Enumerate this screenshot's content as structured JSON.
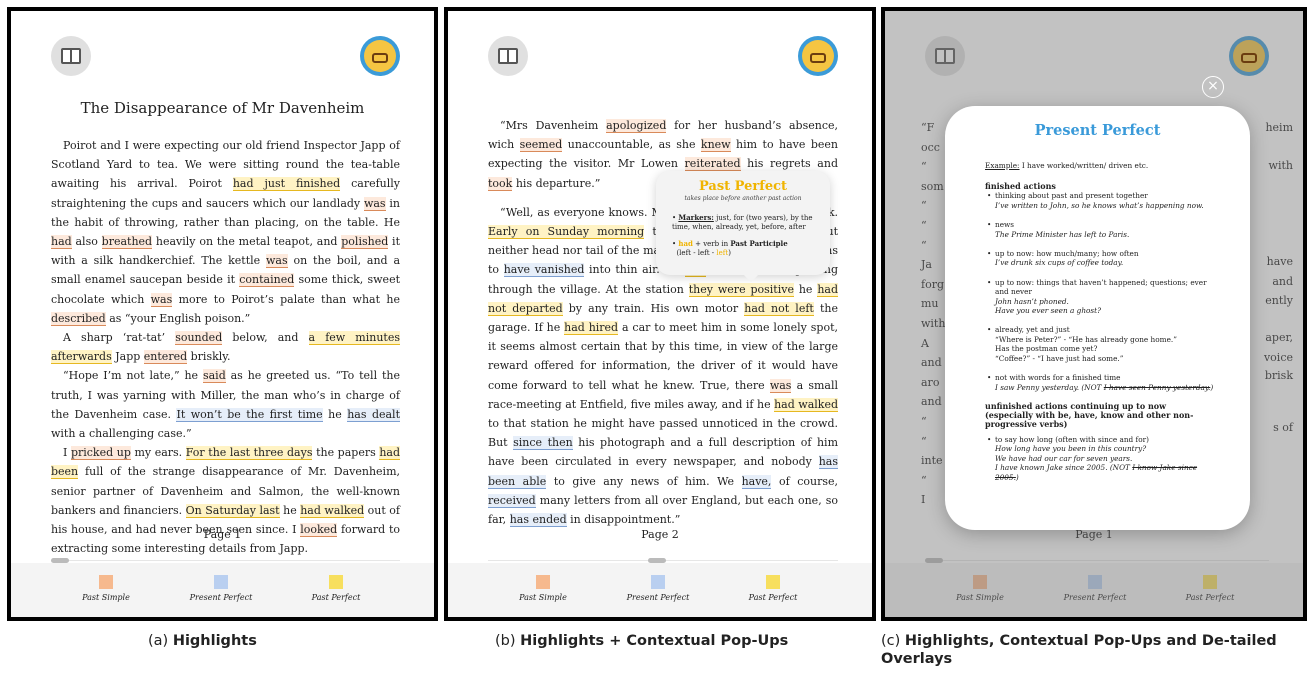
{
  "panels": {
    "p1": {
      "title": "The Disappearance of Mr Davenheim",
      "page": "Page 1",
      "paragraphs": [
        [
          [
            "Poirot and I were expecting our old friend Inspector Japp of Scotland Yard to tea. We were sitting round the tea-table awaiting his arrival. Poirot ",
            ""
          ],
          [
            "had just finished",
            "y"
          ],
          [
            " carefully straightening the cups and saucers which our landlady ",
            ""
          ],
          [
            "was",
            "o"
          ],
          [
            " in the habit of throwing, rather than placing, on the table. He ",
            ""
          ],
          [
            "had",
            "o"
          ],
          [
            " also ",
            ""
          ],
          [
            "breathed",
            "o"
          ],
          [
            " heavily on the metal teapot, and ",
            ""
          ],
          [
            "polished",
            "o"
          ],
          [
            " it with a silk handkerchief. The kettle ",
            ""
          ],
          [
            "was",
            "o"
          ],
          [
            " on the boil, and a small enamel saucepan beside it ",
            ""
          ],
          [
            "contained",
            "o"
          ],
          [
            " some thick, sweet chocolate which ",
            ""
          ],
          [
            "was",
            "o"
          ],
          [
            " more to Poirot’s palate than what he ",
            ""
          ],
          [
            "described",
            "o"
          ],
          [
            " as “your English poison.”",
            ""
          ]
        ],
        [
          [
            "A sharp ‘rat-tat’ ",
            ""
          ],
          [
            "sounded",
            "o"
          ],
          [
            " below, and ",
            ""
          ],
          [
            "a few minutes afterwards",
            "y"
          ],
          [
            " Japp ",
            ""
          ],
          [
            "entered",
            "o"
          ],
          [
            " briskly.",
            ""
          ]
        ],
        [
          [
            "“Hope I’m not late,” he ",
            ""
          ],
          [
            "said",
            "o"
          ],
          [
            " as he greeted us. “To tell the truth, I was yarning with Miller, the man who’s in charge of the Davenheim case. ",
            ""
          ],
          [
            "It won’t be the first time",
            "b"
          ],
          [
            " he ",
            ""
          ],
          [
            "has dealt",
            "b"
          ],
          [
            " with a challenging case.”",
            ""
          ]
        ],
        [
          [
            "I ",
            ""
          ],
          [
            "pricked up",
            "o"
          ],
          [
            " my ears. ",
            ""
          ],
          [
            "For the last three days",
            "y"
          ],
          [
            " the papers ",
            ""
          ],
          [
            "had been",
            "y"
          ],
          [
            " full of the strange disappearance of Mr. Davenheim, senior partner of Davenheim and Salmon, the well-known bankers and financiers. ",
            ""
          ],
          [
            "On Saturday last",
            "y"
          ],
          [
            " he ",
            ""
          ],
          [
            "had walked",
            "y"
          ],
          [
            " out of his house, and had never been seen since. I ",
            ""
          ],
          [
            "looked",
            "o"
          ],
          [
            " forward to extracting some interesting details from Japp.",
            ""
          ]
        ]
      ]
    },
    "p2": {
      "page": "Page 2",
      "paragraphs": [
        [
          [
            "“Mrs Davenheim ",
            ""
          ],
          [
            "apologized",
            "o"
          ],
          [
            " for her husband’s absence, wich ",
            ""
          ],
          [
            "seemed",
            "o"
          ],
          [
            " unaccountable, as she ",
            ""
          ],
          [
            "knew",
            "o"
          ],
          [
            " him to have been expecting the visitor. Mr Lowen ",
            ""
          ],
          [
            "reiterated",
            "o"
          ],
          [
            " his regrets and ",
            ""
          ],
          [
            "took",
            "o"
          ],
          [
            " his departure.”",
            ""
          ]
        ],
        [
          [
            "“Well, as everyone knows. Mr Davenheim never came back. ",
            ""
          ],
          [
            "Early on Sunday morning",
            "y"
          ],
          [
            " the police were called in, but neither head nor tail of the matter could they make. He seems to ",
            ""
          ],
          [
            "have vanished",
            "b"
          ],
          [
            " into thin air. He ",
            ""
          ],
          [
            "had",
            "y"
          ],
          [
            " not been seen passing through the village. At the station ",
            ""
          ],
          [
            "they were positive",
            "y"
          ],
          [
            " he ",
            ""
          ],
          [
            "had not departed",
            "y"
          ],
          [
            " by any train. His own motor ",
            ""
          ],
          [
            "had not left",
            "y"
          ],
          [
            " the garage. If he ",
            ""
          ],
          [
            "had hired",
            "y"
          ],
          [
            " a car to meet him in some lonely spot, it seems almost certain that by this time, in view of the large reward offered for information, the driver of it would have come forward to tell what he knew. True, there ",
            ""
          ],
          [
            "was",
            "o"
          ],
          [
            " a small race-meeting at Entfield, five miles away, and if he ",
            ""
          ],
          [
            "had walked",
            "y"
          ],
          [
            " to that station he might have passed unnoticed in the crowd. But ",
            ""
          ],
          [
            "since then",
            "b"
          ],
          [
            " his photograph and a full description of him have been circulated in every newspaper, and nobody ",
            ""
          ],
          [
            "has been able",
            "b"
          ],
          [
            " to give any news of him. We ",
            ""
          ],
          [
            "have,",
            "b"
          ],
          [
            " of course, ",
            ""
          ],
          [
            "received",
            "b"
          ],
          [
            " many letters from all over England, but each one, so far, ",
            ""
          ],
          [
            "has ended",
            "b"
          ],
          [
            " in disappointment.”",
            ""
          ]
        ]
      ],
      "popup": {
        "title": "Past Perfect",
        "subtitle": "takes place before another past action",
        "markers_label": "Markers:",
        "markers_text": " just, for (two years), by the time, when, already, yet, before, after",
        "rule_had": "had",
        "rule_mid": " + verb in ",
        "rule_pp": "Past Participle",
        "rule_ex_start": "(left - left - ",
        "rule_ex_hl": "left",
        "rule_ex_end": ")"
      }
    },
    "p3": {
      "page": "Page 1",
      "bg_fragments": [
        "“F",
        "occ",
        "“",
        "som",
        "“",
        "“",
        "“",
        "Ja",
        "forg",
        "mu",
        "with",
        "A",
        "and",
        "aro",
        "and",
        "“",
        "“",
        "inte",
        "“",
        "I",
        "heim",
        "with",
        "have",
        "and",
        "ently",
        "aper,",
        "voice",
        "brisk",
        "s of"
      ],
      "card": {
        "title": "Present Perfect",
        "example_label": "Example:",
        "example_text": " I have worked/written/ driven etc.",
        "section1": "finished actions",
        "bullets1": [
          {
            "main": "thinking about past and present together",
            "ex": [
              "I’ve written to John, so he knows what’s happening now."
            ]
          },
          {
            "main": "news",
            "ex": [
              "The Prime Minister has left to Paris."
            ]
          },
          {
            "main": "up to now: how much/many; how often",
            "ex": [
              "I’ve drunk six cups of coffee today."
            ]
          },
          {
            "main": "up to now: things that haven’t happened; questions; ever and never",
            "ex": [
              "John hasn’t phoned.",
              "Have you ever seen a ghost?"
            ]
          },
          {
            "main": "already, yet and just",
            "plain": [
              "“Where is Peter?” - “He has already gone home.”",
              "Has the postman come yet?",
              "“Coffee?” - “I have just had some.”"
            ]
          }
        ],
        "bullet_words": {
          "main": "not with words for a finished time",
          "ex_start": "I saw Penny yesterday. (NOT ",
          "ex_strike": "I have seen Penny yesterday.",
          "ex_end": ")"
        },
        "section2_line1": "unfinished actions continuing up to now",
        "section2_line2": "(especially with be, have, know and other non-progressive verbs)",
        "bullet_long": {
          "main": "to say how long (often with since and for)",
          "ex": [
            "How long have you been in this country?",
            "We have had our car for seven years."
          ],
          "ex_start": "I have known Jake since 2005. (NOT ",
          "ex_strike": "I know Jake since 2005.",
          "ex_end": ")"
        }
      }
    }
  },
  "legend": [
    "Past Simple",
    "Present Perfect",
    "Past Perfect"
  ],
  "captions": [
    {
      "prefix": "(a) ",
      "bold": "Highlights"
    },
    {
      "prefix": "(b) ",
      "bold": "Highlights + Contextual Pop-Ups"
    },
    {
      "prefix": "(c) ",
      "bold": "Highlights, Contextual Pop-Ups and De-tailed Overlays"
    }
  ],
  "colors": {
    "past_simple": "#f6b98e",
    "present_perfect": "#b9cff0",
    "past_perfect": "#f7df5e",
    "popup_title": "#f0b400",
    "card_title": "#3a9ad9"
  },
  "icons": [
    "book-icon",
    "reader-avatar-icon",
    "close-icon"
  ]
}
